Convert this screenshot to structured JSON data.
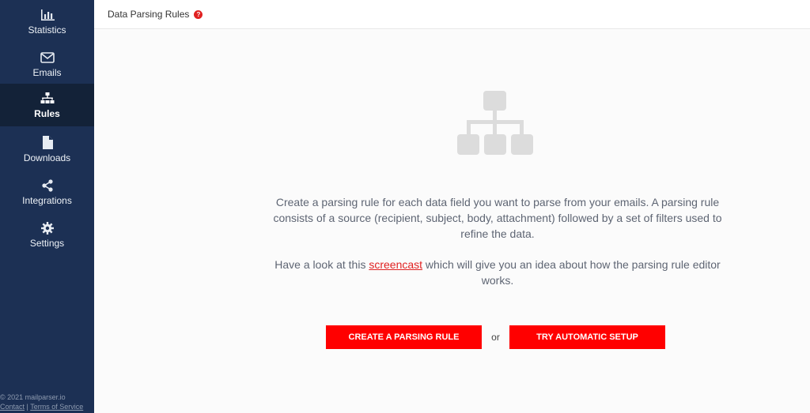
{
  "sidebar": {
    "items": [
      {
        "label": "Statistics",
        "icon": "bar-chart-icon"
      },
      {
        "label": "Emails",
        "icon": "envelope-icon"
      },
      {
        "label": "Rules",
        "icon": "sitemap-icon",
        "active": true
      },
      {
        "label": "Downloads",
        "icon": "file-icon"
      },
      {
        "label": "Integrations",
        "icon": "share-icon"
      },
      {
        "label": "Settings",
        "icon": "gear-icon"
      }
    ],
    "footer": {
      "copyright": "© 2021 mailparser.io",
      "contact": "Contact",
      "separator": "|",
      "terms": "Terms of Service"
    }
  },
  "header": {
    "title": "Data Parsing Rules",
    "help": "?"
  },
  "main": {
    "description": "Create a parsing rule for each data field you want to parse from your emails. A parsing rule consists of a source (recipient, subject, body, attachment) followed by a set of filters used to refine the data.",
    "screencast_prefix": "Have a look at this ",
    "screencast_link": "screencast",
    "screencast_suffix": " which will give you an idea about how the parsing rule editor works.",
    "create_button": "CREATE A PARSING RULE",
    "or_text": "or",
    "auto_button": "TRY AUTOMATIC SETUP"
  },
  "colors": {
    "sidebar_bg": "#1c3054",
    "sidebar_active": "#132238",
    "accent": "#ff0000",
    "hero_icon": "#dcdcdc"
  }
}
